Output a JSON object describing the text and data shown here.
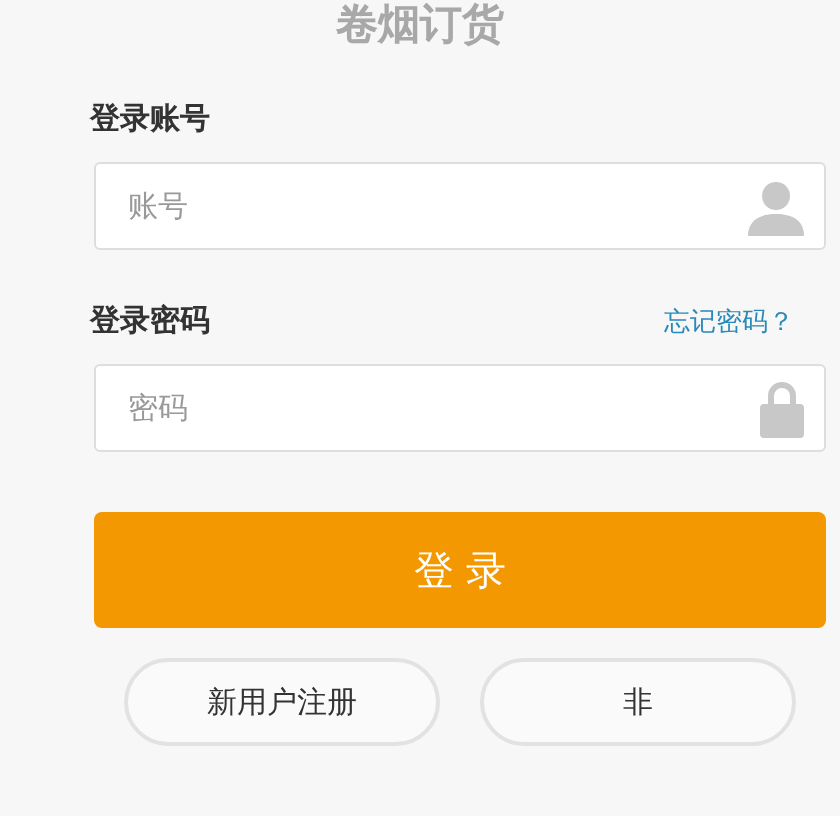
{
  "title": "卷烟订货",
  "account": {
    "label": "登录账号",
    "placeholder": "账号"
  },
  "password": {
    "label": "登录密码",
    "forgot_link": "忘记密码？",
    "placeholder": "密码"
  },
  "login_button": "登 录",
  "buttons": [
    "新用户注册",
    "非"
  ]
}
